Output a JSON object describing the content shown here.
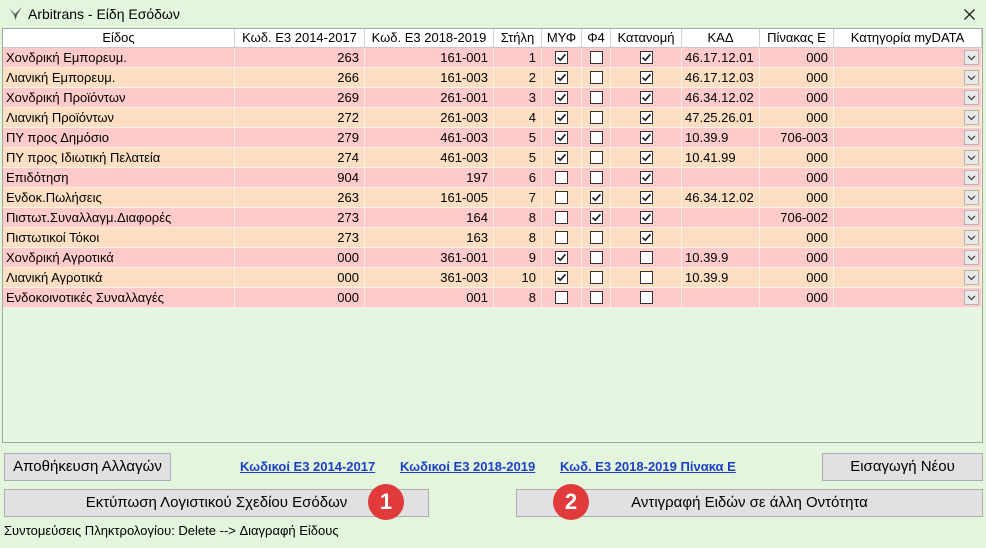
{
  "window": {
    "title": "Arbitrans - Είδη Εσόδων"
  },
  "icons": {
    "app": "arbitrans-bird-icon",
    "close": "close-icon",
    "dropdown": "chevron-down-icon",
    "checkbox_checked": "check-icon"
  },
  "colors": {
    "window_bg": "#e4f5de",
    "row_pink": "#ffcaca",
    "row_peach": "#fcdfc2",
    "link": "#1c3fc4",
    "badge": "#e03a3a"
  },
  "table": {
    "columns": [
      "Είδος",
      "Κωδ. Ε3 2014-2017",
      "Κωδ. Ε3 2018-2019",
      "Στήλη",
      "ΜΥΦ",
      "Φ4",
      "Κατανομή",
      "ΚΑΔ",
      "Πίνακας Ε",
      "Κατηγορία myDATA"
    ],
    "rows": [
      {
        "name": "Χονδρική Εμπορευμ.",
        "e3_2014": "263",
        "e3_2018": "161-001",
        "column": "1",
        "myf": true,
        "f4": false,
        "allocation": true,
        "kad": "46.17.12.01",
        "table_e": "000"
      },
      {
        "name": "Λιανική Εμπορευμ.",
        "e3_2014": "266",
        "e3_2018": "161-003",
        "column": "2",
        "myf": true,
        "f4": false,
        "allocation": true,
        "kad": "46.17.12.03",
        "table_e": "000"
      },
      {
        "name": "Χονδρική Προϊόντων",
        "e3_2014": "269",
        "e3_2018": "261-001",
        "column": "3",
        "myf": true,
        "f4": false,
        "allocation": true,
        "kad": "46.34.12.02",
        "table_e": "000"
      },
      {
        "name": "Λιανική Προϊόντων",
        "e3_2014": "272",
        "e3_2018": "261-003",
        "column": "4",
        "myf": true,
        "f4": false,
        "allocation": true,
        "kad": "47.25.26.01",
        "table_e": "000"
      },
      {
        "name": "ΠΥ προς Δημόσιο",
        "e3_2014": "279",
        "e3_2018": "461-003",
        "column": "5",
        "myf": true,
        "f4": false,
        "allocation": true,
        "kad": "10.39.9",
        "table_e": "706-003"
      },
      {
        "name": "ΠΥ προς Ιδιωτική Πελατεία",
        "e3_2014": "274",
        "e3_2018": "461-003",
        "column": "5",
        "myf": true,
        "f4": false,
        "allocation": true,
        "kad": "10.41.99",
        "table_e": "000"
      },
      {
        "name": "Επιδότηση",
        "e3_2014": "904",
        "e3_2018": "197",
        "column": "6",
        "myf": false,
        "f4": false,
        "allocation": true,
        "kad": "",
        "table_e": "000"
      },
      {
        "name": "Ενδοκ.Πωλήσεις",
        "e3_2014": "263",
        "e3_2018": "161-005",
        "column": "7",
        "myf": false,
        "f4": true,
        "allocation": true,
        "kad": "46.34.12.02",
        "table_e": "000"
      },
      {
        "name": "Πιστωτ.Συναλλαγμ.Διαφορές",
        "e3_2014": "273",
        "e3_2018": "164",
        "column": "8",
        "myf": false,
        "f4": true,
        "allocation": true,
        "kad": "",
        "table_e": "706-002"
      },
      {
        "name": "Πιστωτικοί Τόκοι",
        "e3_2014": "273",
        "e3_2018": "163",
        "column": "8",
        "myf": false,
        "f4": false,
        "allocation": true,
        "kad": "",
        "table_e": "000"
      },
      {
        "name": "Χονδρική Αγροτικά",
        "e3_2014": "000",
        "e3_2018": "361-001",
        "column": "9",
        "myf": true,
        "f4": false,
        "allocation": false,
        "kad": "10.39.9",
        "table_e": "000"
      },
      {
        "name": "Λιανική Αγροτικά",
        "e3_2014": "000",
        "e3_2018": "361-003",
        "column": "10",
        "myf": true,
        "f4": false,
        "allocation": false,
        "kad": "10.39.9",
        "table_e": "000"
      },
      {
        "name": "Ενδοκοινοτικές Συναλλαγές",
        "e3_2014": "000",
        "e3_2018": "001",
        "column": "8",
        "myf": false,
        "f4": false,
        "allocation": false,
        "kad": "",
        "table_e": "000"
      }
    ]
  },
  "buttons": {
    "save": "Αποθήκευση Αλλαγών",
    "insert_new": "Εισαγωγή Νέου",
    "print": "Εκτύπωση Λογιστικού Σχεδίου Εσόδων",
    "copy": "Αντιγραφή Ειδών σε άλλη Οντότητα"
  },
  "links": {
    "e3_2014": "Κωδικοί Ε3 2014-2017",
    "e3_2018": "Κωδικοί Ε3 2018-2019",
    "e3_2018_table_e": "Κωδ. Ε3 2018-2019 Πίνακα Ε"
  },
  "badges": {
    "one": "1",
    "two": "2"
  },
  "shortcuts": "Συντομεύσεις Πληκτρολογίου: Delete --> Διαγραφή Είδους"
}
